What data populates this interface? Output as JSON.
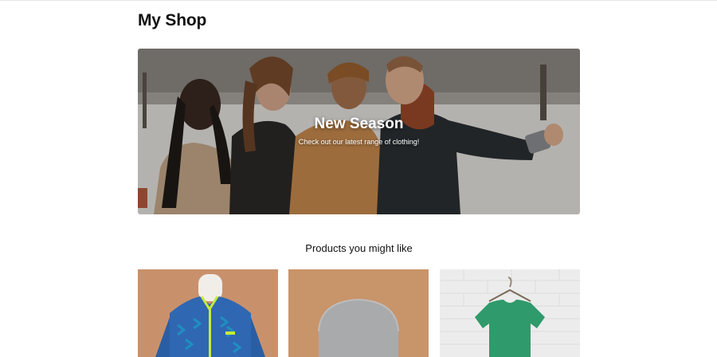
{
  "header": {
    "title": "My Shop"
  },
  "hero": {
    "title": "New Season",
    "subtitle": "Check out our latest range of clothing!"
  },
  "products_section": {
    "title": "Products you might like",
    "items": [
      {
        "image": "blue-jacket-image"
      },
      {
        "image": "grey-beanie-image"
      },
      {
        "image": "green-tshirt-image"
      }
    ]
  }
}
